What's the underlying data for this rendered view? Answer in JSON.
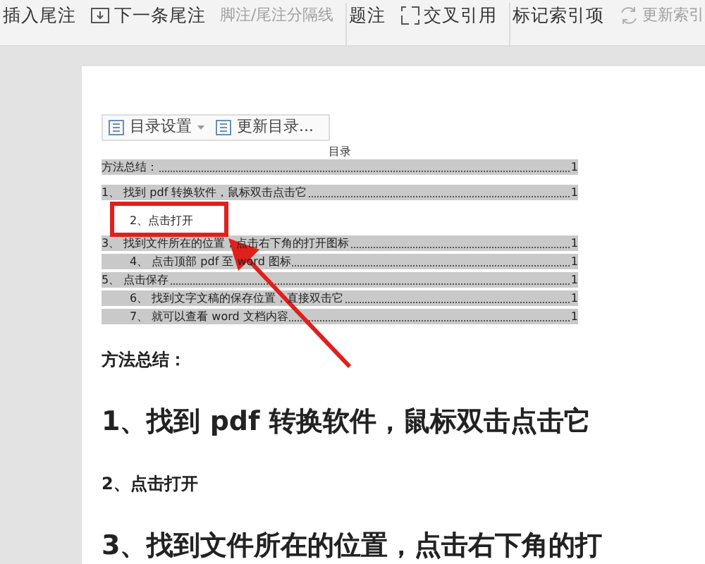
{
  "toolbar": {
    "groups": [
      {
        "items": [
          {
            "label": "插入尾注",
            "disabled": false
          },
          {
            "label": "下一条尾注",
            "disabled": false
          },
          {
            "label": "脚注/尾注分隔线",
            "disabled": true
          }
        ]
      },
      {
        "items": [
          {
            "label": "题注",
            "disabled": false
          },
          {
            "label": "交叉引用",
            "disabled": false
          }
        ]
      },
      {
        "items": [
          {
            "label": "标记索引项",
            "disabled": false
          },
          {
            "label": "更新索引",
            "disabled": true
          }
        ]
      }
    ]
  },
  "toc_toolbar": {
    "buttons": [
      {
        "label": "目录设置",
        "dropdown": true
      },
      {
        "label": "更新目录...",
        "dropdown": false
      }
    ]
  },
  "toc": {
    "title": "目录",
    "entries": [
      {
        "text": "方法总结：",
        "page": "1",
        "shaded": true
      },
      {
        "text": "1、 找到 pdf 转换软件，鼠标双击点击它",
        "page": "1",
        "shaded": true,
        "children": [
          {
            "text": "2、点击打开",
            "shaded": false
          }
        ]
      },
      {
        "text": "3、 找到文件所在的位置，点击右下角的打开图标",
        "page": "1",
        "shaded": true,
        "children": [
          {
            "text": "4、 点击顶部 pdf 至 word 图标",
            "page": "1",
            "shaded": true
          }
        ]
      },
      {
        "text": "5、 点击保存",
        "page": "1",
        "shaded": true,
        "children": [
          {
            "text": "6、 找到文字文稿的保存位置，直接双击它",
            "page": "1",
            "shaded": true
          },
          {
            "text": "7、 就可以查看 word 文档内容",
            "page": "1",
            "shaded": true
          }
        ]
      }
    ]
  },
  "body": [
    {
      "kind": "small",
      "text": "方法总结："
    },
    {
      "kind": "large",
      "text": "1、找到 pdf 转换软件，鼠标双击点击它"
    },
    {
      "kind": "small",
      "text": "2、点击打开"
    },
    {
      "kind": "large",
      "text": "3、找到文件所在的位置，点击右下角的打"
    }
  ]
}
